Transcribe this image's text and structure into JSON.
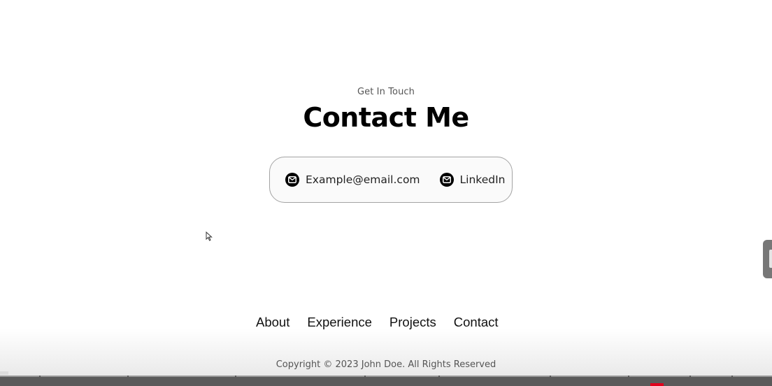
{
  "contact": {
    "subtitle": "Get In Touch",
    "title": "Contact Me",
    "items": [
      {
        "icon": "mail-icon",
        "label": "Example@email.com"
      },
      {
        "icon": "mail-icon",
        "label": "LinkedIn"
      }
    ]
  },
  "nav": {
    "items": [
      "About",
      "Experience",
      "Projects",
      "Contact"
    ]
  },
  "footer": {
    "copyright": "Copyright © 2023 John Doe. All Rights Reserved"
  }
}
